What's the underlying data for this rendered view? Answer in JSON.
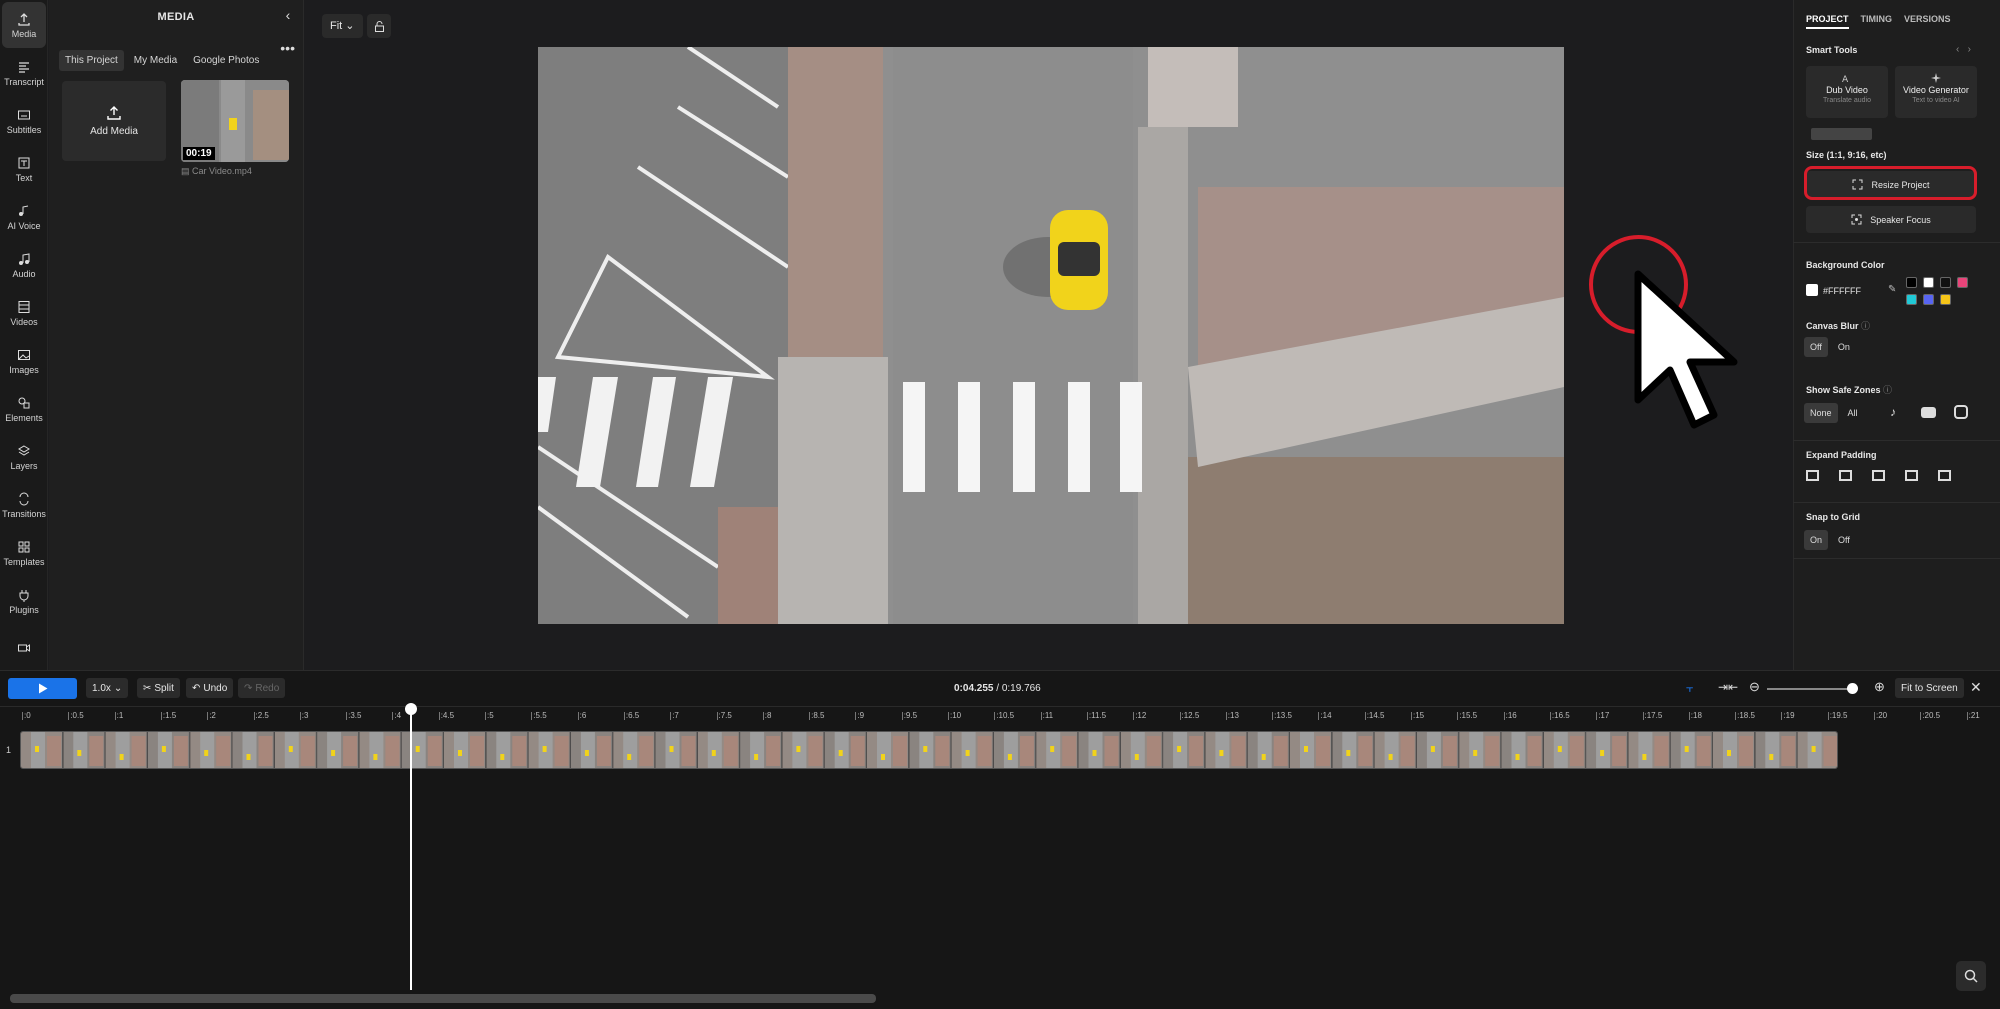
{
  "rail": [
    {
      "label": "Media",
      "icon": "upload-icon"
    },
    {
      "label": "Transcript",
      "icon": "transcript-icon"
    },
    {
      "label": "Subtitles",
      "icon": "subtitles-icon"
    },
    {
      "label": "Text",
      "icon": "text-icon"
    },
    {
      "label": "AI Voice",
      "icon": "ai-voice-icon"
    },
    {
      "label": "Audio",
      "icon": "music-icon"
    },
    {
      "label": "Videos",
      "icon": "film-icon"
    },
    {
      "label": "Images",
      "icon": "image-icon"
    },
    {
      "label": "Elements",
      "icon": "shapes-icon"
    },
    {
      "label": "Layers",
      "icon": "layers-icon"
    },
    {
      "label": "Transitions",
      "icon": "transitions-icon"
    },
    {
      "label": "Templates",
      "icon": "grid-icon"
    },
    {
      "label": "Plugins",
      "icon": "plugin-icon"
    }
  ],
  "media": {
    "title": "MEDIA",
    "tabs": [
      "This Project",
      "My Media",
      "Google Photos"
    ],
    "add_label": "Add Media",
    "file_duration": "00:19",
    "file_name": "Car Video.mp4"
  },
  "canvas": {
    "fit_label": "Fit"
  },
  "right": {
    "tabs": [
      "PROJECT",
      "TIMING",
      "VERSIONS"
    ],
    "smart_tools_label": "Smart Tools",
    "tools": [
      {
        "title": "Dub Video",
        "sub": "Translate audio"
      },
      {
        "title": "Video Generator",
        "sub": "Text to video AI"
      }
    ],
    "size_label": "Size (1:1, 9:16, etc)",
    "resize_label": "Resize Project",
    "speaker_label": "Speaker Focus",
    "bg_label": "Background Color",
    "bg_value": "#FFFFFF",
    "swatches": [
      "#000000",
      "#ffffff",
      "#111111",
      "#e8457a",
      "#20c9d6",
      "#5865f2",
      "#f5c518"
    ],
    "blur_label": "Canvas Blur",
    "blur_options": [
      "Off",
      "On"
    ],
    "safe_label": "Show Safe Zones",
    "safe_options": [
      "None",
      "All"
    ],
    "padding_label": "Expand Padding",
    "snap_label": "Snap to Grid",
    "snap_options": [
      "On",
      "Off"
    ]
  },
  "timeline": {
    "speed": "1.0x",
    "split": "Split",
    "undo": "Undo",
    "redo": "Redo",
    "current_time": "0:04.255",
    "total_time": "/ 0:19.766",
    "fit_screen": "Fit to Screen",
    "track_number": "1",
    "ticks": [
      ":0",
      ":0.5",
      ":1",
      ":1.5",
      ":2",
      ":2.5",
      ":3",
      ":3.5",
      ":4",
      ":4.5",
      ":5",
      ":5.5",
      ":6",
      ":6.5",
      ":7",
      ":7.5",
      ":8",
      ":8.5",
      ":9",
      ":9.5",
      ":10",
      ":10.5",
      ":11",
      ":11.5",
      ":12",
      ":12.5",
      ":13",
      ":13.5",
      ":14",
      ":14.5",
      ":15",
      ":15.5",
      ":16",
      ":16.5",
      ":17",
      ":17.5",
      ":18",
      ":18.5",
      ":19",
      ":19.5",
      ":20",
      ":20.5",
      ":21"
    ]
  },
  "colors": {
    "accent": "#1a73e8",
    "highlight": "#d71d2b"
  }
}
